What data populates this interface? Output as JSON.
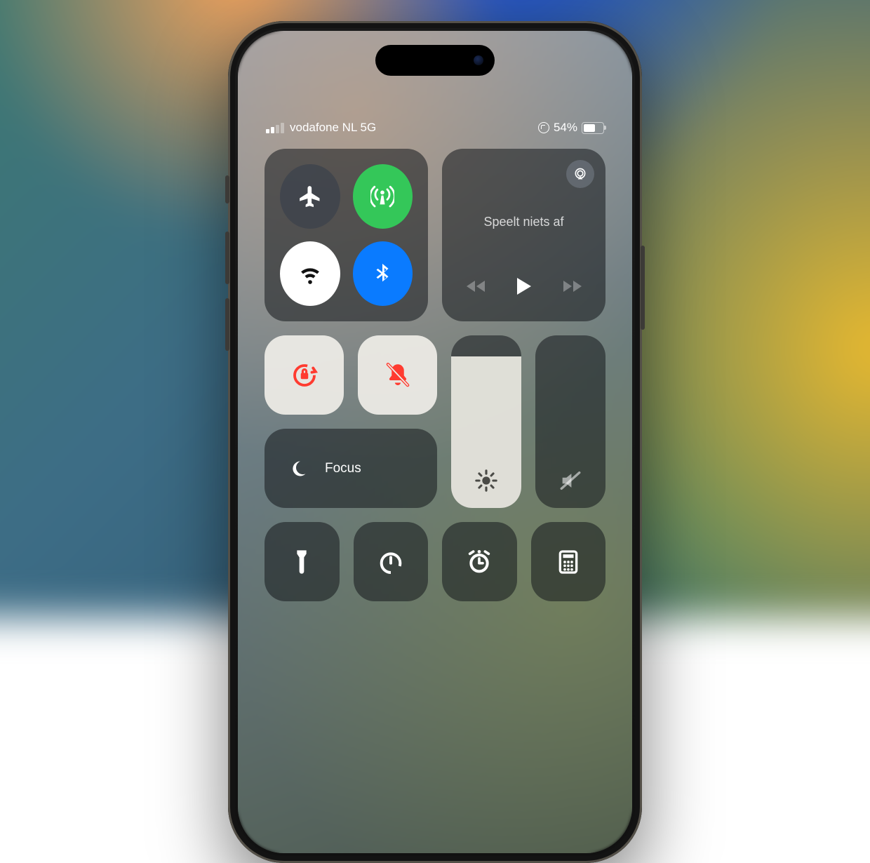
{
  "status": {
    "signal_active_bars": 2,
    "signal_total_bars": 4,
    "carrier": "vodafone NL 5G",
    "rotation_lock": true,
    "battery_percent_label": "54%",
    "battery_level": 54
  },
  "connectivity": {
    "airplane": {
      "on": false
    },
    "cellular": {
      "on": true,
      "color": "#34c759"
    },
    "wifi": {
      "on": true,
      "color": "#ffffff"
    },
    "bluetooth": {
      "on": true,
      "color": "#0a7bff"
    }
  },
  "media": {
    "now_playing_label": "Speelt niets af",
    "has_previous": false,
    "has_next": false
  },
  "toggles": {
    "rotation_lock": {
      "on": true,
      "icon_color": "#ff3b30"
    },
    "silent": {
      "on": true,
      "icon_color": "#ff3b30"
    }
  },
  "focus": {
    "label": "Focus",
    "on": false
  },
  "sliders": {
    "brightness": {
      "level_percent": 88
    },
    "volume": {
      "level_percent": 0,
      "muted": true
    }
  },
  "utilities": [
    "flashlight",
    "timer",
    "alarm",
    "calculator"
  ]
}
